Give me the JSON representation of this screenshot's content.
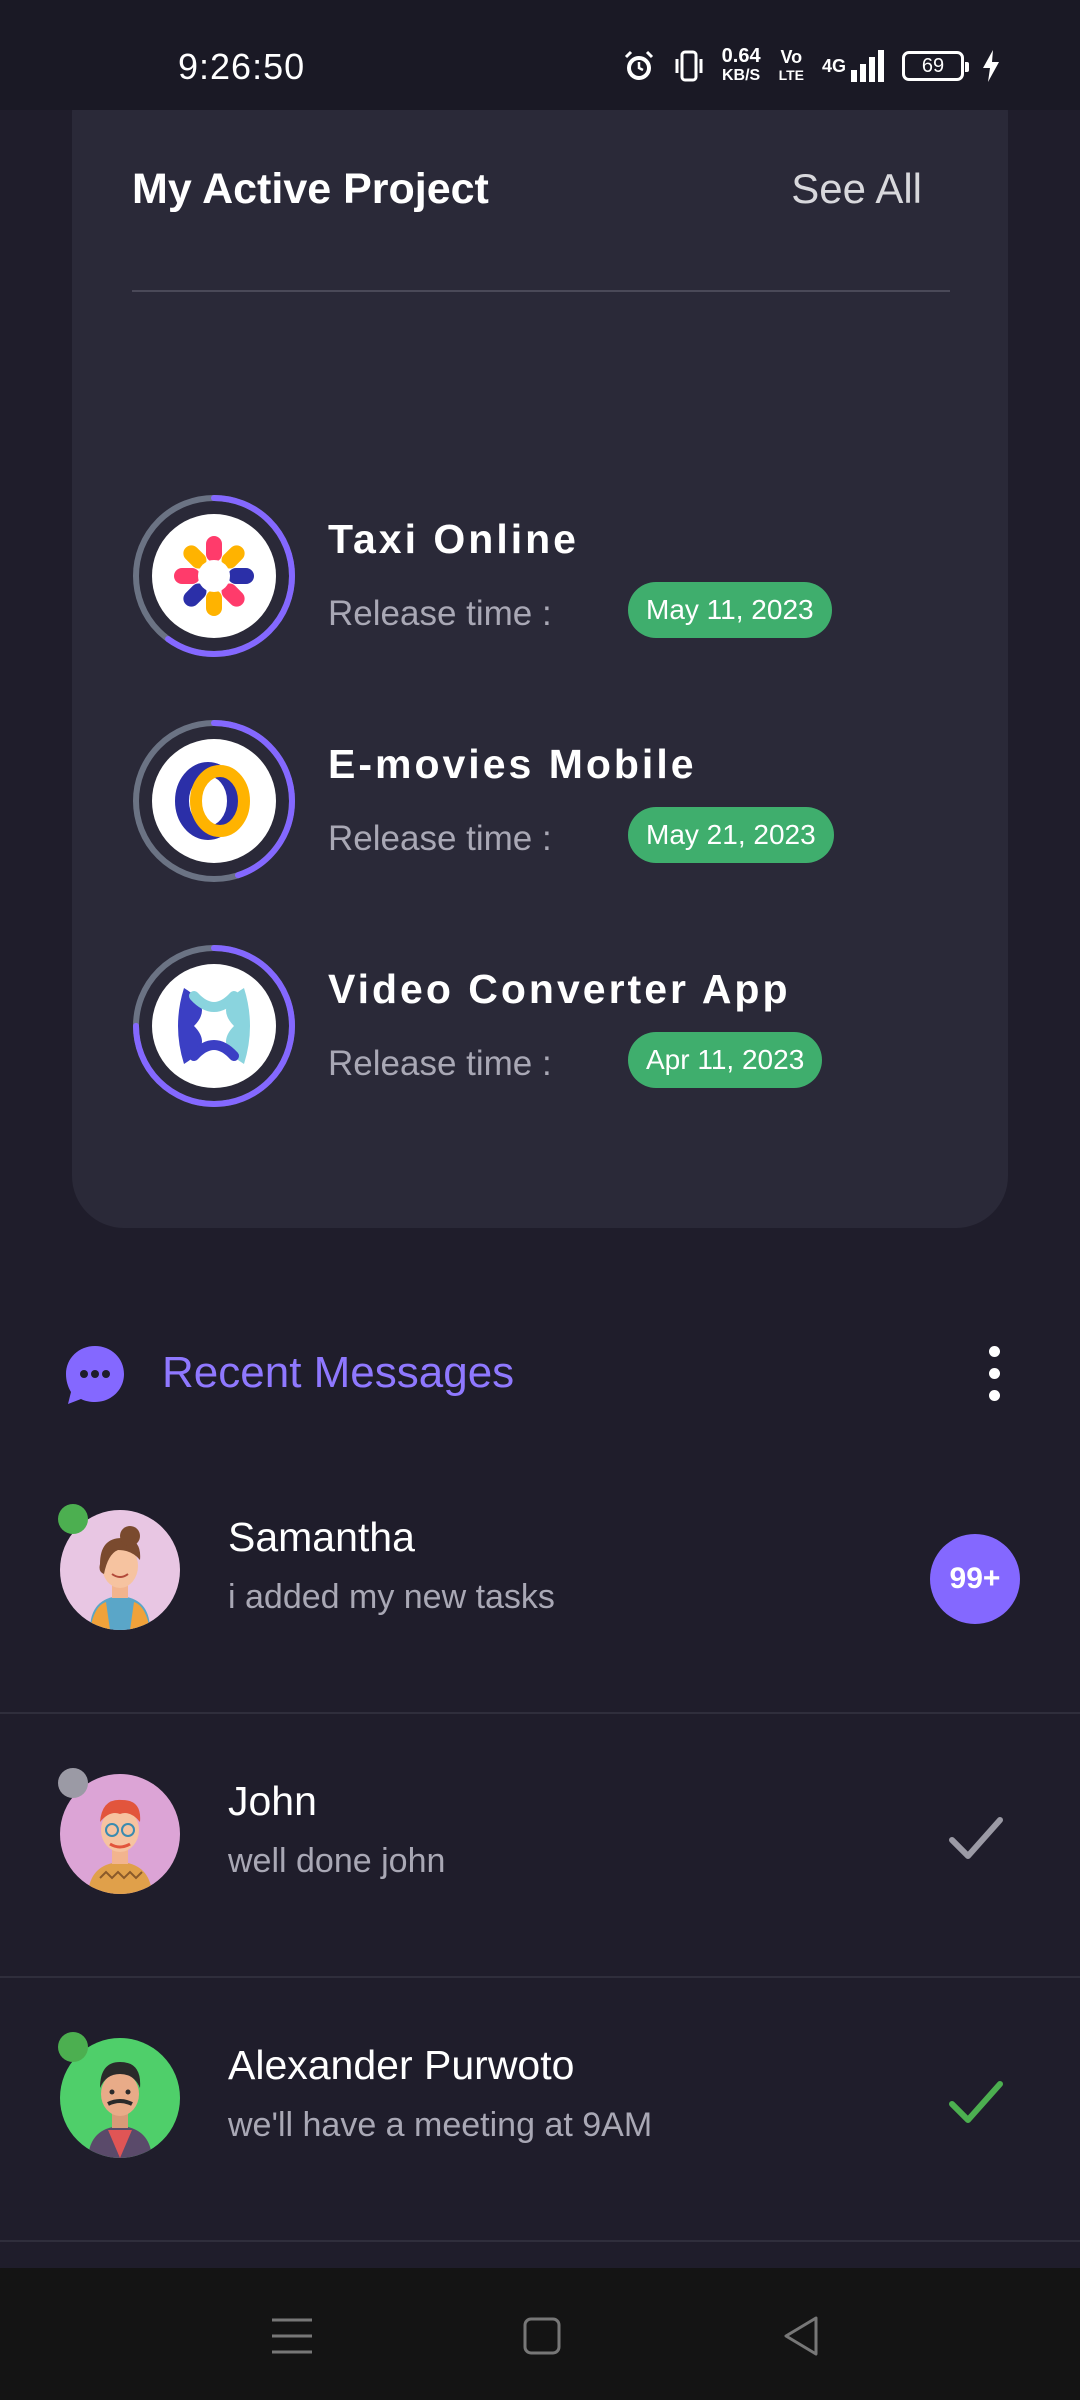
{
  "status_bar": {
    "time": "9:26:50",
    "net_speed_value": "0.64",
    "net_speed_unit": "KB/S",
    "volte_top": "Vo",
    "volte_bottom": "LTE",
    "network": "4G",
    "battery": "69",
    "icons": [
      "alarm-icon",
      "vibrate-icon",
      "signal-icon",
      "charging-icon"
    ]
  },
  "project_card": {
    "title": "My Active Project",
    "see_all": "See All",
    "projects": [
      {
        "name": "Taxi Online",
        "release_label": "Release time :",
        "release_date": "May 11, 2023",
        "ring_progress": 0.6
      },
      {
        "name": "E-movies Mobile",
        "release_label": "Release time :",
        "release_date": "May 21, 2023",
        "ring_progress": 0.45
      },
      {
        "name": "Video Converter App",
        "release_label": "Release time :",
        "release_date": "Apr 11, 2023",
        "ring_progress": 0.75
      }
    ]
  },
  "messages": {
    "title": "Recent Messages",
    "items": [
      {
        "name": "Samantha",
        "preview": "i added my new tasks",
        "online": true,
        "badge": "99+"
      },
      {
        "name": "John",
        "preview": "well done john",
        "online": false,
        "status": "read"
      },
      {
        "name": "Alexander Purwoto",
        "preview": "we'll have a meeting at 9AM",
        "online": true,
        "status": "delivered"
      }
    ]
  },
  "colors": {
    "accent": "#8468ff",
    "success": "#3fae6d",
    "background": "#1f1d2b",
    "card": "#2a2938"
  }
}
